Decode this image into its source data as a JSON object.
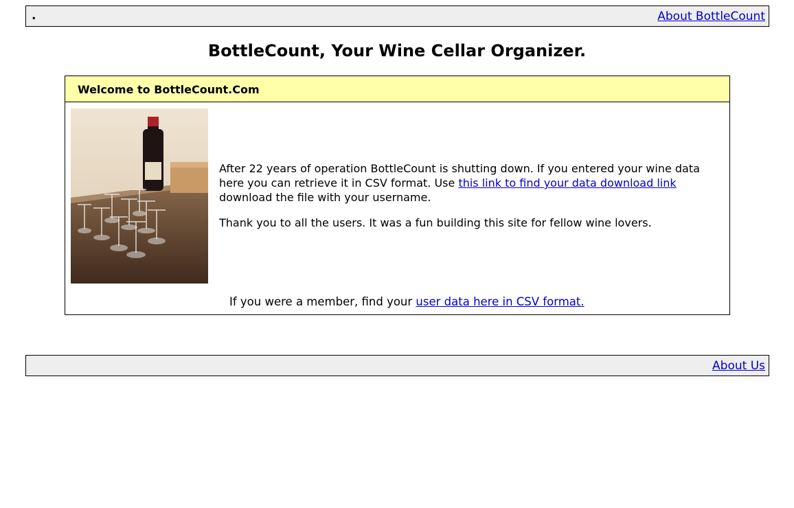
{
  "header": {
    "dot": ".",
    "about_link": "About BottleCount"
  },
  "page_title": "BottleCount, Your Wine Cellar Organizer.",
  "panel": {
    "heading": "Welcome to BottleCount.Com",
    "image_icon": "wine-glasses-photo",
    "paragraph1": {
      "before": "After 22 years of operation BottleCount is shutting down. If you entered your wine data here you can retrieve it in CSV format. Use ",
      "link": "this link to find your data download link",
      "after": " download the file with your username."
    },
    "paragraph2": "Thank you to all the users. It was a fun building this site for fellow wine lovers.",
    "member_line": {
      "before": "If you were a member, find your ",
      "link": "user data here in CSV format."
    }
  },
  "footer": {
    "about_link": "About Us"
  },
  "colors": {
    "bar_background": "#eeeeee",
    "panel_header_background": "#ffffaa",
    "link": "#0000cc"
  }
}
